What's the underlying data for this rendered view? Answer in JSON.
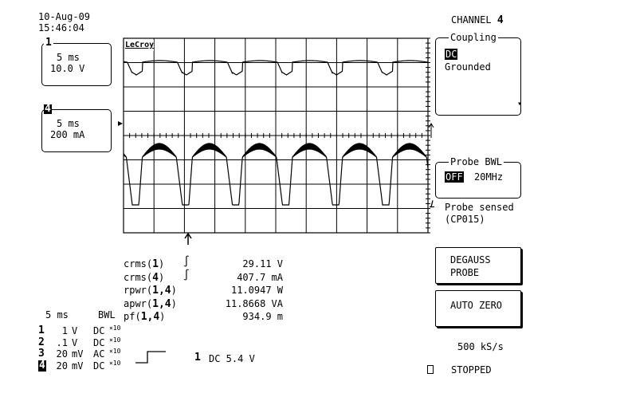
{
  "header": {
    "date": "10-Aug-09",
    "time": "15:46:04"
  },
  "traces": [
    {
      "label": "1",
      "timebase": "5 ms",
      "scale": "10.0 V"
    },
    {
      "label": "4",
      "timebase": "5 ms",
      "scale": "200 mA"
    }
  ],
  "logo": "LeCroy",
  "measurements": [
    {
      "name": "crms(",
      "ch": "1",
      "close": ")",
      "icon": "sine-cycle-icon",
      "value": "29.11 V"
    },
    {
      "name": "crms(",
      "ch": "4",
      "close": ")",
      "icon": "sine-cycle-icon",
      "value": "407.7 mA"
    },
    {
      "name": "rpwr(",
      "ch": "1,4",
      "close": ")",
      "value": "11.0947 W"
    },
    {
      "name": "apwr(",
      "ch": "1,4",
      "close": ")",
      "value": "11.8668 VA"
    },
    {
      "name": "pf(",
      "ch": "1,4",
      "close": ")",
      "value": "934.9 m"
    }
  ],
  "timebase": {
    "value": "5 ms",
    "bwl": "BWL"
  },
  "channels": [
    {
      "num": "1",
      "volts": "1",
      "unit": "V",
      "coupling": "DC",
      "probe": "×10"
    },
    {
      "num": "2",
      "volts": ".1",
      "unit": "V",
      "coupling": "DC",
      "probe": "×10"
    },
    {
      "num": "3",
      "volts": "20",
      "unit": "mV",
      "coupling": "AC",
      "probe": "×10"
    },
    {
      "num": "4",
      "volts": "20",
      "unit": "mV",
      "coupling": "DC",
      "probe": "×10"
    }
  ],
  "trigger": {
    "source": "1",
    "text": "DC 5.4 V",
    "icon": "rising-edge-icon"
  },
  "menu": {
    "title": "CHANNEL",
    "channel": "4",
    "coupling": {
      "label": "Coupling",
      "options": [
        "DC",
        "Grounded"
      ],
      "selected": "DC"
    },
    "probe_bwl": {
      "label": "Probe BWL",
      "options": [
        "OFF",
        "20MHz"
      ],
      "selected": "OFF"
    },
    "probe_sensed": "Probe sensed",
    "probe_model": "(CP015)",
    "degauss_line1": "DEGAUSS",
    "degauss_line2": "PROBE",
    "auto_zero": "AUTO ZERO"
  },
  "status": {
    "sample_rate": "500 kS/s",
    "state": "STOPPED"
  }
}
